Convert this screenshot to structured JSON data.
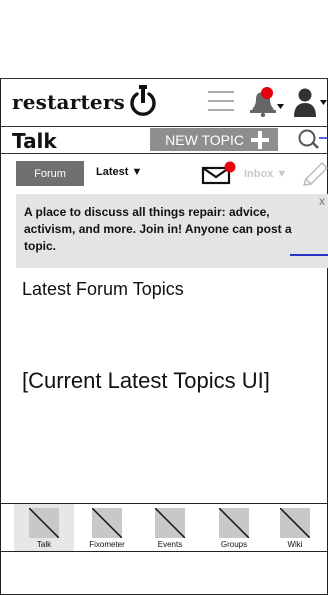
{
  "header": {
    "brand": "restarters",
    "icons": [
      "power-icon",
      "hamburger-menu-icon",
      "bell-icon",
      "user-icon"
    ]
  },
  "talkbar": {
    "title": "Talk",
    "new_topic_label": "NEW TOPIC"
  },
  "tabs": {
    "forum_label": "Forum",
    "latest_label": "Latest ▼",
    "inbox_label": "Inbox ▼"
  },
  "notice": {
    "text": "A place to discuss all things repair: advice, activism, and more. Join in! Anyone can post a topic.",
    "close": "x"
  },
  "main": {
    "heading": "Latest Forum Topics",
    "placeholder": "[Current Latest Topics UI]"
  },
  "bottom_nav": {
    "items": [
      {
        "label": "Talk",
        "active": true
      },
      {
        "label": "Fixometer",
        "active": false
      },
      {
        "label": "Events",
        "active": false
      },
      {
        "label": "Groups",
        "active": false
      },
      {
        "label": "Wiki",
        "active": false
      }
    ]
  },
  "colors": {
    "notification": "#e8000b",
    "button_gray": "#8e8e8e",
    "tab_gray": "#707070",
    "notice_bg": "#e4e4e4",
    "link_blue": "#2536c8"
  }
}
